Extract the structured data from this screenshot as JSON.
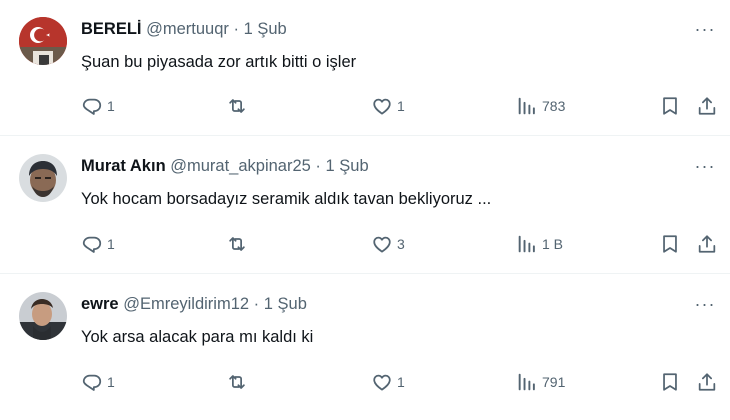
{
  "tweets": [
    {
      "name": "BERELİ",
      "handle": "@mertuuqr",
      "separator": "·",
      "time": "1 Şub",
      "text": "Şuan bu piyasada zor artık bitti o işler",
      "more": "···",
      "replies": "1",
      "retweets": "",
      "likes": "1",
      "views": "783"
    },
    {
      "name": "Murat Akın",
      "handle": "@murat_akpinar25",
      "separator": "·",
      "time": "1 Şub",
      "text": "Yok hocam borsadayız seramik aldık tavan bekliyoruz ...",
      "more": "···",
      "replies": "1",
      "retweets": "",
      "likes": "3",
      "views": "1 B"
    },
    {
      "name": "ewre",
      "handle": "@Emreyildirim12",
      "separator": "·",
      "time": "1 Şub",
      "text": "Yok arsa alacak para mı kaldı ki",
      "more": "···",
      "replies": "1",
      "retweets": "",
      "likes": "1",
      "views": "791"
    }
  ],
  "icons": {
    "reply": "reply-icon",
    "retweet": "retweet-icon",
    "like": "heart-icon",
    "views": "views-icon",
    "bookmark": "bookmark-icon",
    "share": "share-icon",
    "more": "more-icon"
  },
  "colors": {
    "text": "#0f1419",
    "secondary": "#536471",
    "divider": "#eff3f4",
    "avatar1_flag": "#c0352a"
  }
}
